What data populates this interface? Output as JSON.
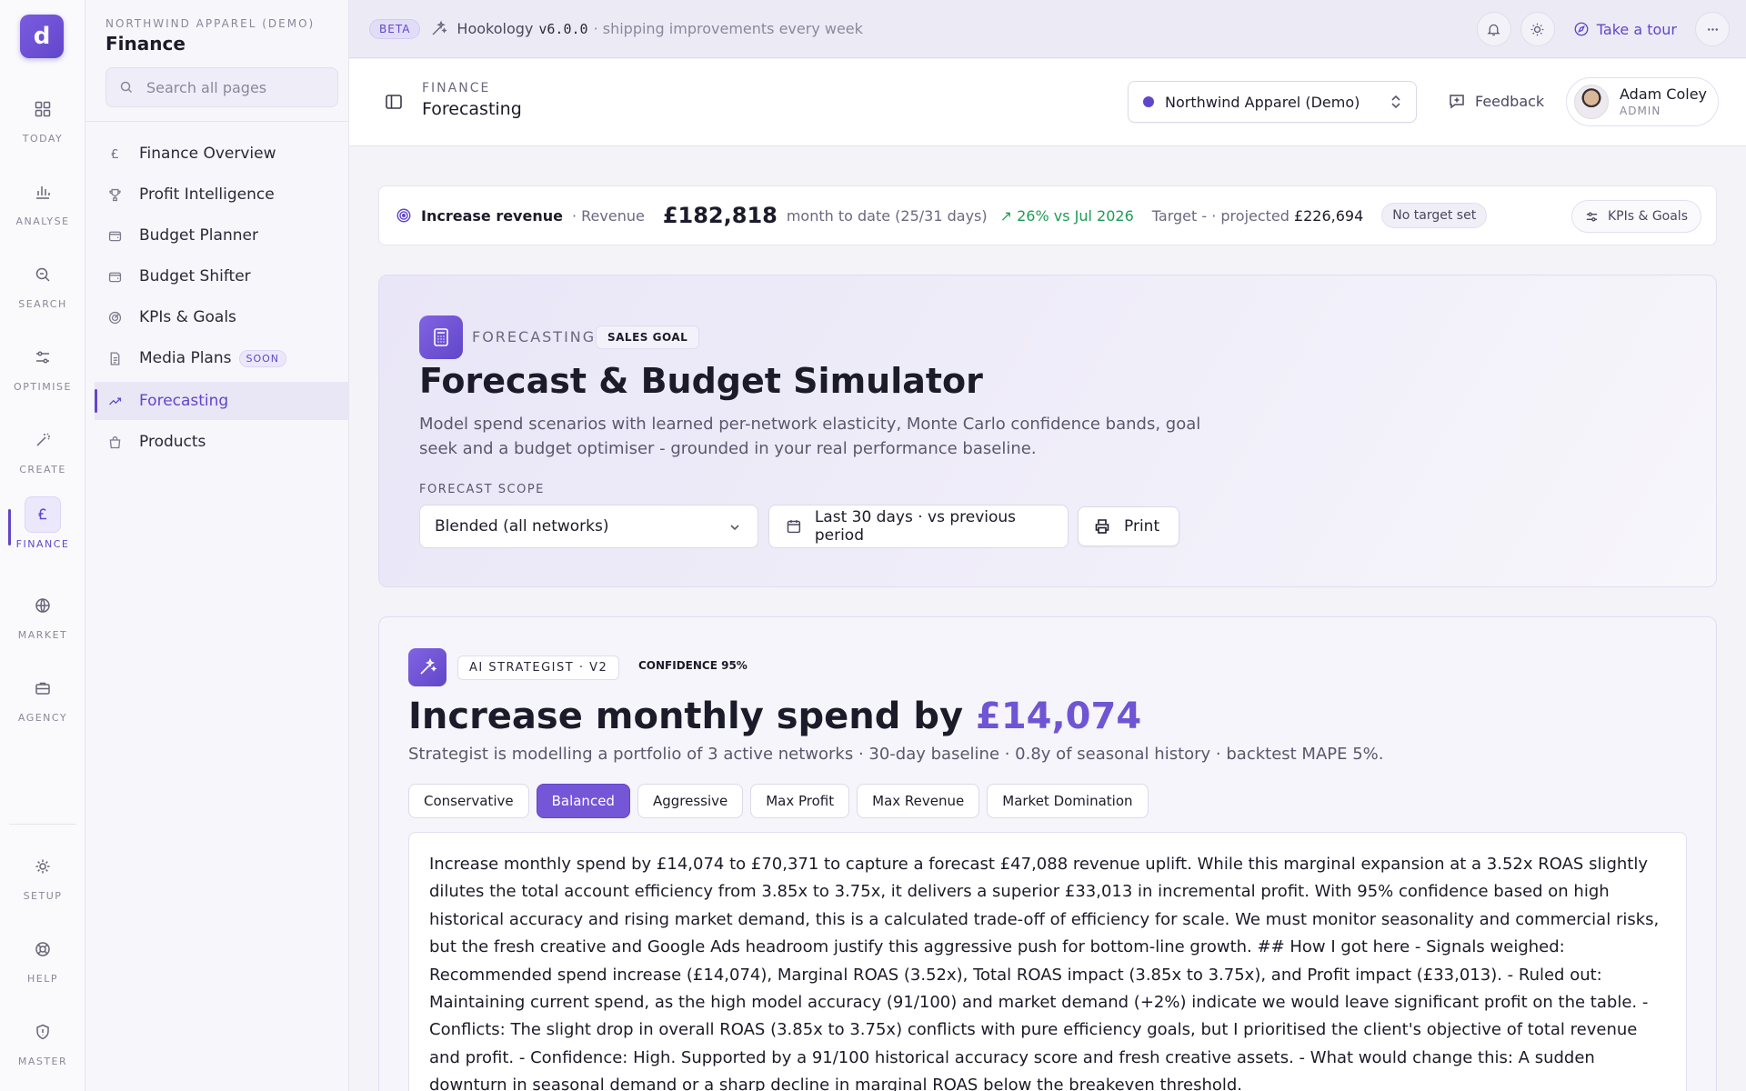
{
  "rail": {
    "logo": "d",
    "items": [
      {
        "label": "TODAY",
        "icon": "grid-icon"
      },
      {
        "label": "ANALYSE",
        "icon": "bar-chart-icon"
      },
      {
        "label": "SEARCH",
        "icon": "search-icon"
      },
      {
        "label": "OPTIMISE",
        "icon": "sliders-icon"
      },
      {
        "label": "CREATE",
        "icon": "magic-wand-icon"
      },
      {
        "label": "FINANCE",
        "icon": "pound-icon",
        "active": true
      },
      {
        "label": "MARKET",
        "icon": "globe-icon"
      },
      {
        "label": "AGENCY",
        "icon": "briefcase-icon"
      }
    ],
    "bottom_items": [
      {
        "label": "SETUP",
        "icon": "gear-icon"
      },
      {
        "label": "HELP",
        "icon": "lifebuoy-icon"
      },
      {
        "label": "MASTER",
        "icon": "shield-icon"
      }
    ]
  },
  "sidebar": {
    "org": "NORTHWIND APPAREL (DEMO)",
    "section": "Finance",
    "search_placeholder": "Search all pages",
    "items": [
      {
        "label": "Finance Overview",
        "icon": "pound-icon"
      },
      {
        "label": "Profit Intelligence",
        "icon": "trophy-icon"
      },
      {
        "label": "Budget Planner",
        "icon": "wallet-icon"
      },
      {
        "label": "Budget Shifter",
        "icon": "wallet-icon"
      },
      {
        "label": "KPIs & Goals",
        "icon": "target-icon"
      },
      {
        "label": "Media Plans",
        "icon": "document-icon",
        "badge": "SOON"
      },
      {
        "label": "Forecasting",
        "icon": "trending-up-icon",
        "active": true
      },
      {
        "label": "Products",
        "icon": "shopping-bag-icon"
      }
    ]
  },
  "topbar": {
    "badge": "BETA",
    "app_name": "Hookology",
    "version": "v6.0.0",
    "tagline": "· shipping improvements every week",
    "tour_label": "Take a tour"
  },
  "header": {
    "crumb": "FINANCE",
    "title": "Forecasting",
    "org_select": "Northwind Apparel (Demo)",
    "feedback_label": "Feedback",
    "user_name": "Adam Coley",
    "user_role": "ADMIN"
  },
  "kpi": {
    "goal": "Increase revenue",
    "metric": "· Revenue",
    "value": "£182,818",
    "period": "month to date (25/31 days)",
    "change": "26% vs Jul 2026",
    "target": "Target - · projected",
    "projected": "£226,694",
    "badge": "No target set",
    "button": "KPIs & Goals"
  },
  "hero": {
    "eyebrow": "FORECASTING",
    "chip": "SALES GOAL",
    "title": "Forecast & Budget Simulator",
    "description": "Model spend scenarios with learned per-network elasticity, Monte Carlo confidence bands, goal seek and a budget optimiser - grounded in your real performance baseline.",
    "scope_label": "FORECAST SCOPE",
    "scope_value": "Blended (all networks)",
    "date_range": "Last 30 days · vs previous period",
    "print_label": "Print"
  },
  "strategist": {
    "chip": "AI STRATEGIST · V2",
    "confidence": "CONFIDENCE 95%",
    "title_prefix": "Increase monthly spend by",
    "title_amount": "£14,074",
    "subtitle": "Strategist is modelling a portfolio of 3 active networks · 30-day baseline · 0.8y of seasonal history · backtest MAPE 5%.",
    "modes": [
      {
        "label": "Conservative"
      },
      {
        "label": "Balanced",
        "active": true
      },
      {
        "label": "Aggressive"
      },
      {
        "label": "Max Profit"
      },
      {
        "label": "Max Revenue"
      },
      {
        "label": "Market Domination"
      }
    ],
    "narrative": "Increase monthly spend by £14,074 to £70,371 to capture a forecast £47,088 revenue uplift. While this marginal expansion at a 3.52x ROAS slightly dilutes the total account efficiency from 3.85x to 3.75x, it delivers a superior £33,013 in incremental profit. With 95% confidence based on high historical accuracy and rising market demand, this is a calculated trade-off of efficiency for scale. We must monitor seasonality and commercial risks, but the fresh creative and Google Ads headroom justify this aggressive push for bottom-line growth. ## How I got here - Signals weighed: Recommended spend increase (£14,074), Marginal ROAS (3.52x), Total ROAS impact (3.85x to 3.75x), and Profit impact (£33,013). - Ruled out: Maintaining current spend, as the high model accuracy (91/100) and market demand (+2%) indicate we would leave significant profit on the table. - Conflicts: The slight drop in overall ROAS (3.85x to 3.75x) conflicts with pure efficiency goals, but I prioritised the client's objective of total revenue and profit. - Confidence: High. Supported by a 91/100 historical accuracy score and fresh creative assets. - What would change this: A sudden downturn in seasonal demand or a sharp decline in marginal ROAS below the breakeven threshold."
  },
  "colors": {
    "accent": "#6246c9",
    "positive": "#1f9d55"
  }
}
